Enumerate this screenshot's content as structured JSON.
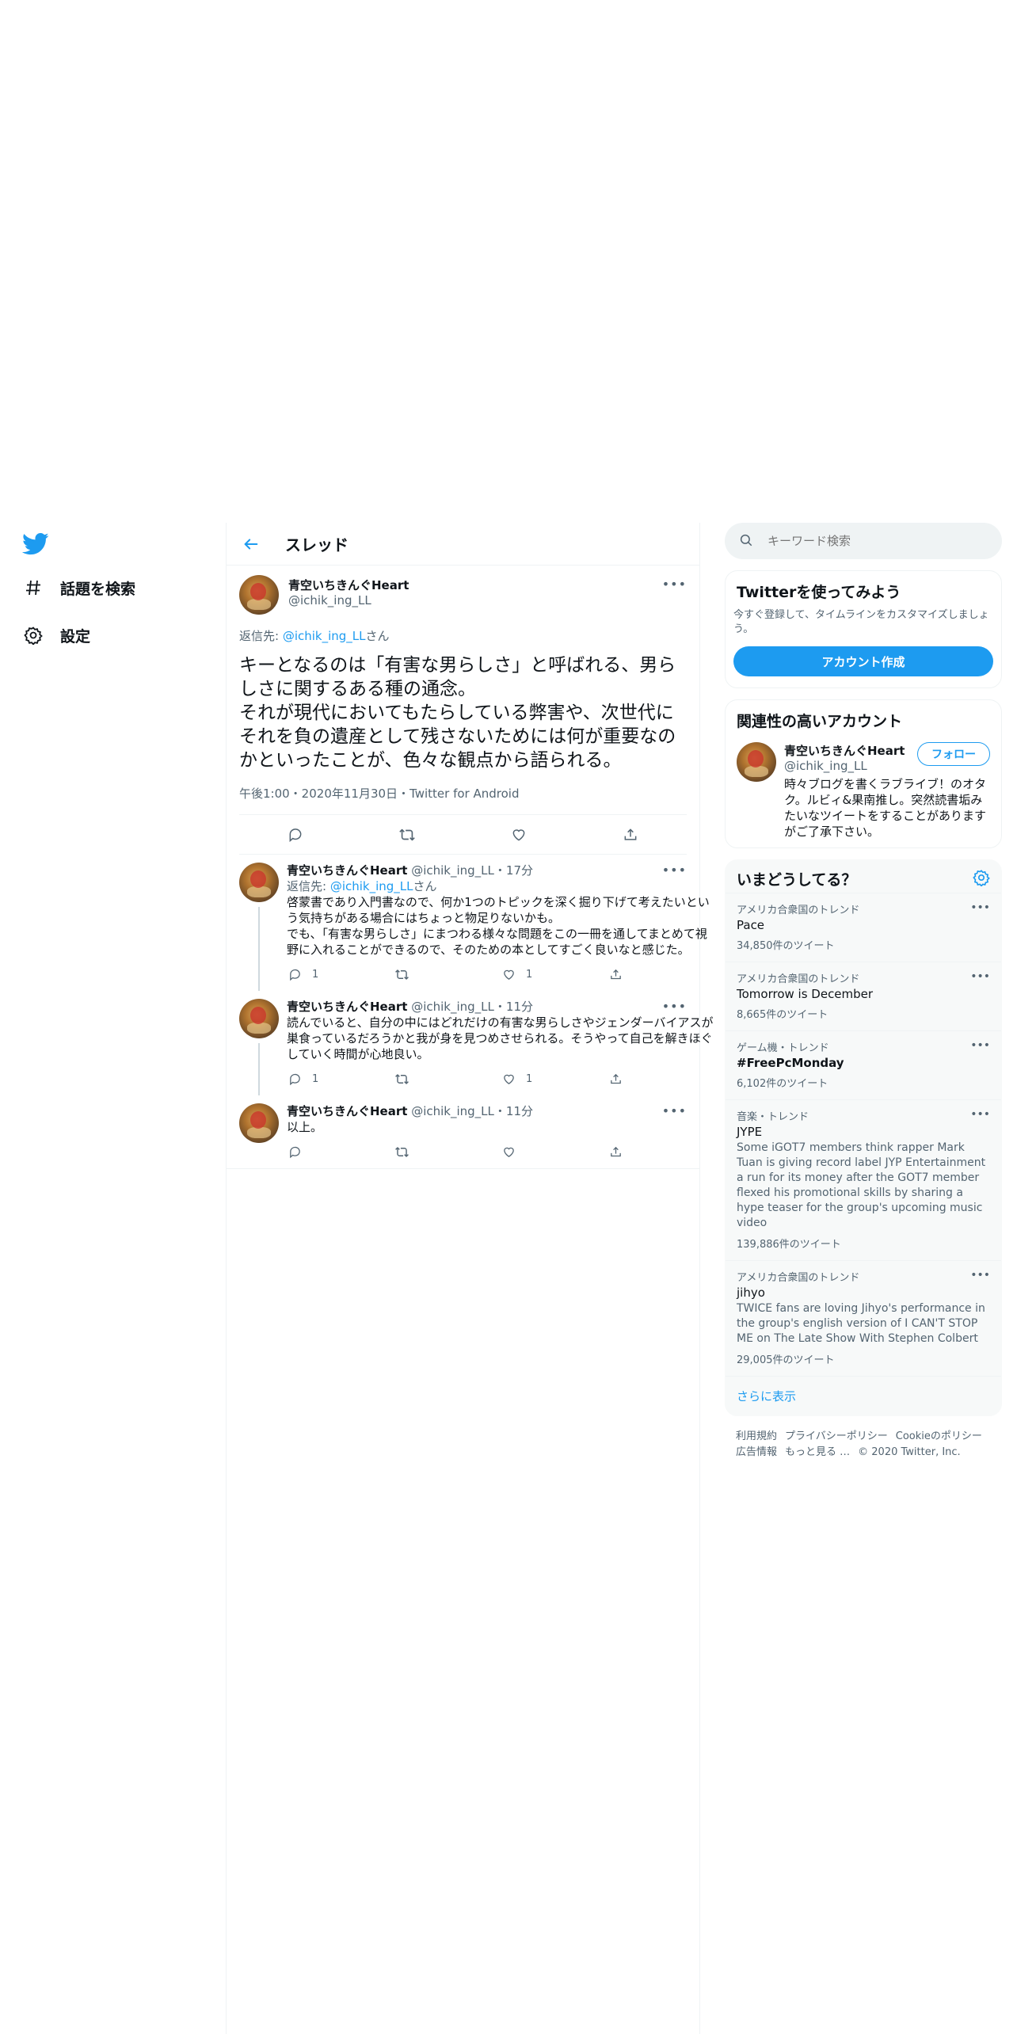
{
  "nav": {
    "items": [
      {
        "label": "話題を検索",
        "icon": "hashtag-icon"
      },
      {
        "label": "設定",
        "icon": "gear-icon"
      }
    ]
  },
  "thread": {
    "title": "スレッド"
  },
  "main_tweet": {
    "name": "青空いちきんぐHeart",
    "handle": "@ichik_ing_LL",
    "reply_prefix": "返信先: ",
    "reply_handle": "@ichik_ing_LL",
    "reply_suffix": "さん",
    "text": "キーとなるのは「有害な男らしさ」と呼ばれる、男らしさに関するある種の通念。\nそれが現代においてもたらしている弊害や、次世代にそれを負の遺産として残さないためには何が重要なのかといったことが、色々な観点から語られる。",
    "meta": "午後1:00・2020年11月30日・Twitter for Android"
  },
  "replies": [
    {
      "name": "青空いちきんぐHeart",
      "handle": "@ichik_ing_LL",
      "time": "17分",
      "reply_prefix": "返信先: ",
      "reply_handle": "@ichik_ing_LL",
      "reply_suffix": "さん",
      "text": "啓蒙書であり入門書なので、何か1つのトピックを深く掘り下げて考えたいという気持ちがある場合にはちょっと物足りないかも。\nでも、「有害な男らしさ」にまつわる様々な問題をこの一冊を通してまとめて視野に入れることができるので、そのための本としてすごく良いなと感じた。",
      "reply_count": "1",
      "retweet_count": "",
      "like_count": "1"
    },
    {
      "name": "青空いちきんぐHeart",
      "handle": "@ichik_ing_LL",
      "time": "11分",
      "text": "読んでいると、自分の中にはどれだけの有害な男らしさやジェンダーバイアスが巣食っているだろうかと我が身を見つめさせられる。そうやって自己を解きほぐしていく時間が心地良い。",
      "reply_count": "1",
      "retweet_count": "",
      "like_count": "1"
    },
    {
      "name": "青空いちきんぐHeart",
      "handle": "@ichik_ing_LL",
      "time": "11分",
      "text": "以上。",
      "reply_count": "",
      "retweet_count": "",
      "like_count": ""
    }
  ],
  "search": {
    "placeholder": "キーワード検索"
  },
  "signup": {
    "title": "Twitterを使ってみよう",
    "desc": "今すぐ登録して、タイムラインをカスタマイズしましょう。",
    "button": "アカウント作成"
  },
  "related": {
    "title": "関連性の高いアカウント",
    "name": "青空いちきんぐHeart",
    "handle": "@ichik_ing_LL",
    "follow": "フォロー",
    "bio": "時々ブログを書くラブライブ！のオタク。ルビィ&果南推し。突然読書垢みたいなツイートをすることがありますがご了承下さい。"
  },
  "trends": {
    "title": "いまどうしてる？",
    "items": [
      {
        "context": "アメリカ合衆国のトレンド",
        "name": "Pace",
        "desc": "",
        "count": "34,850件のツイート"
      },
      {
        "context": "アメリカ合衆国のトレンド",
        "name": "Tomorrow is December",
        "desc": "",
        "count": "8,665件のツイート"
      },
      {
        "context": "ゲーム機・トレンド",
        "name": "#FreePcMonday",
        "desc": "",
        "count": "6,102件のツイート"
      },
      {
        "context": "音楽・トレンド",
        "name": "JYPE",
        "desc": "Some iGOT7 members think rapper Mark Tuan is giving record label JYP Entertainment a run for its money after the GOT7 member flexed his promotional skills by sharing a hype teaser for the group's upcoming music video",
        "count": "139,886件のツイート"
      },
      {
        "context": "アメリカ合衆国のトレンド",
        "name": "jihyo",
        "desc": "TWICE fans are loving Jihyo's performance in the group's english version of I CAN'T STOP ME on The Late Show With Stephen Colbert",
        "count": "29,005件のツイート"
      }
    ],
    "show_more": "さらに表示"
  },
  "footer": {
    "links": [
      "利用規約",
      "プライバシーポリシー",
      "Cookieのポリシー",
      "広告情報",
      "もっと見る …"
    ],
    "copyright": "© 2020 Twitter, Inc."
  },
  "colors": {
    "accent": "#1d9bf0",
    "text": "#0f1419",
    "muted": "#536471",
    "border": "#eff3f4"
  }
}
